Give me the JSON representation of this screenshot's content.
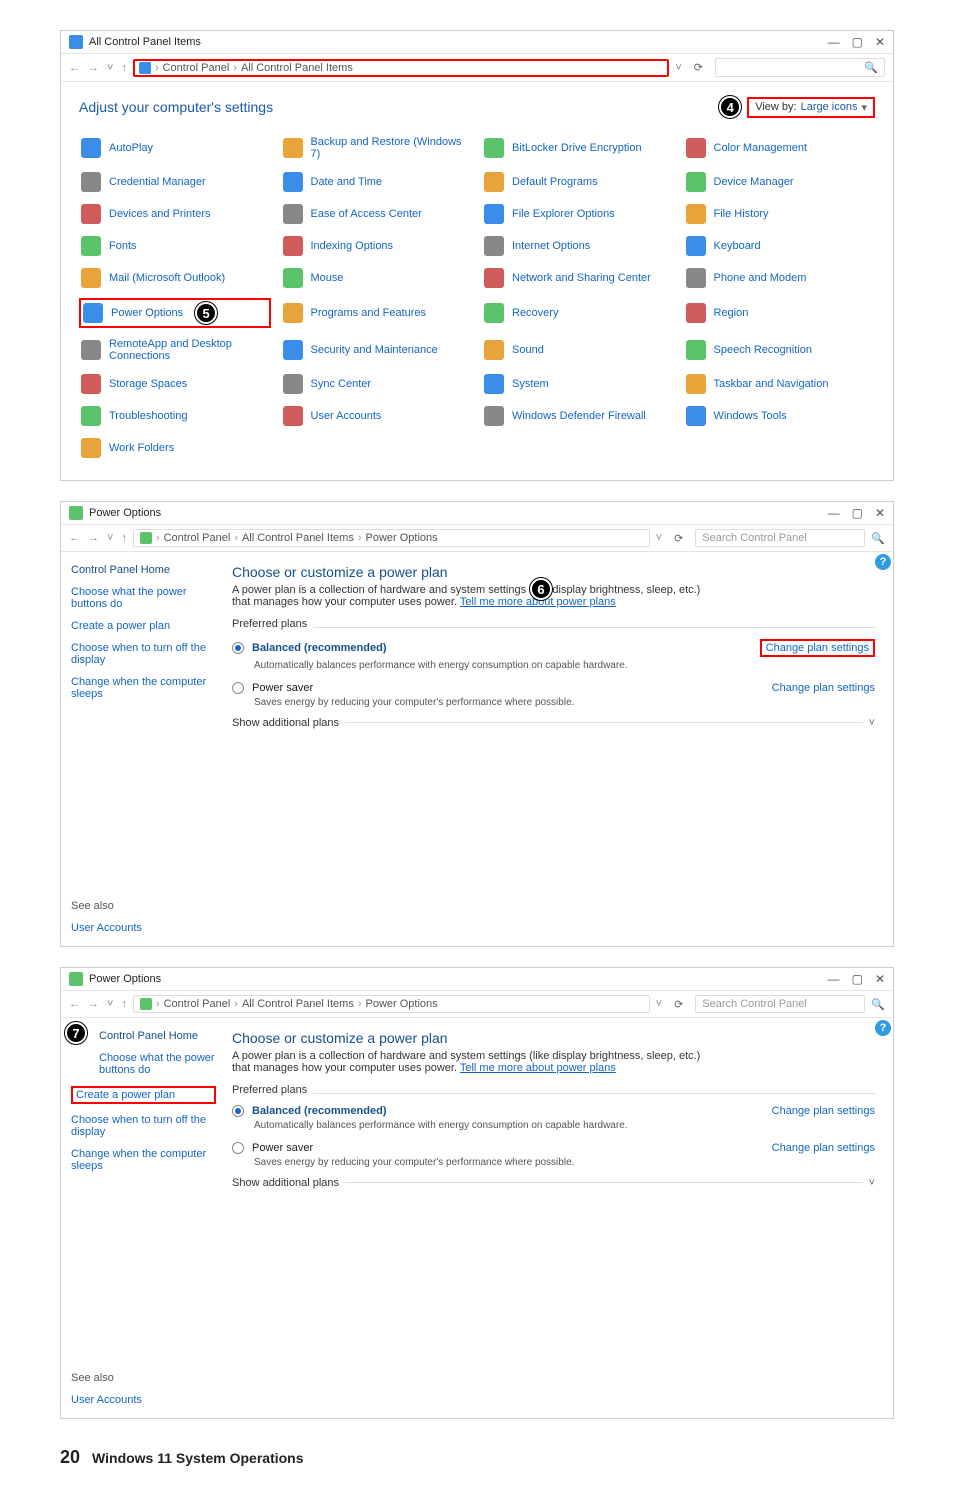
{
  "page_footer": {
    "number": "20",
    "title": "Windows 11 System Operations"
  },
  "callouts": {
    "c4": "4",
    "c5": "5",
    "c6": "6",
    "c7": "7"
  },
  "win1": {
    "title": "All Control Panel Items",
    "breadcrumb": [
      "Control Panel",
      "All Control Panel Items"
    ],
    "search_icon": "🔍",
    "view_by_label": "View by:",
    "view_by_value": "Large icons",
    "header": "Adjust your computer's settings",
    "items": [
      "AutoPlay",
      "Backup and Restore (Windows 7)",
      "BitLocker Drive Encryption",
      "Color Management",
      "Credential Manager",
      "Date and Time",
      "Default Programs",
      "Device Manager",
      "Devices and Printers",
      "Ease of Access Center",
      "File Explorer Options",
      "File History",
      "Fonts",
      "Indexing Options",
      "Internet Options",
      "Keyboard",
      "Mail (Microsoft Outlook)",
      "Mouse",
      "Network and Sharing Center",
      "Phone and Modem",
      "Power Options",
      "Programs and Features",
      "Recovery",
      "Region",
      "RemoteApp and Desktop Connections",
      "Security and Maintenance",
      "Sound",
      "Speech Recognition",
      "Storage Spaces",
      "Sync Center",
      "System",
      "Taskbar and Navigation",
      "Troubleshooting",
      "User Accounts",
      "Windows Defender Firewall",
      "Windows Tools",
      "Work Folders"
    ],
    "red_items": [
      "Power Options"
    ],
    "win_btns": {
      "min": "—",
      "max": "▢",
      "close": "✕"
    }
  },
  "po_common": {
    "title": "Power Options",
    "breadcrumb": [
      "Control Panel",
      "All Control Panel Items",
      "Power Options"
    ],
    "search_placeholder": "Search Control Panel",
    "side": {
      "home": "Control Panel Home",
      "links": [
        "Choose what the power buttons do",
        "Create a power plan",
        "Choose when to turn off the display",
        "Change when the computer sleeps"
      ],
      "seealso_hdr": "See also",
      "seealso": [
        "User Accounts"
      ]
    },
    "main": {
      "h1": "Choose or customize a power plan",
      "desc_pre": "A power plan is a collection of hardware and system settings (like display brightness, sleep, etc.) that manages how your computer uses power. ",
      "desc_link": "Tell me more about power plans",
      "preferred": "Preferred plans",
      "balanced": "Balanced (recommended)",
      "balanced_desc": "Automatically balances performance with energy consumption on capable hardware.",
      "saver": "Power saver",
      "saver_desc": "Saves energy by reducing your computer's performance where possible.",
      "change_link": "Change plan settings",
      "show_additional": "Show additional plans"
    }
  },
  "win2": {
    "red_change_plan": true,
    "red_side_link_index": -1,
    "callout_on_desc": true
  },
  "win3": {
    "red_change_plan": false,
    "red_side_link_index": 1,
    "callout_on_home": true
  }
}
